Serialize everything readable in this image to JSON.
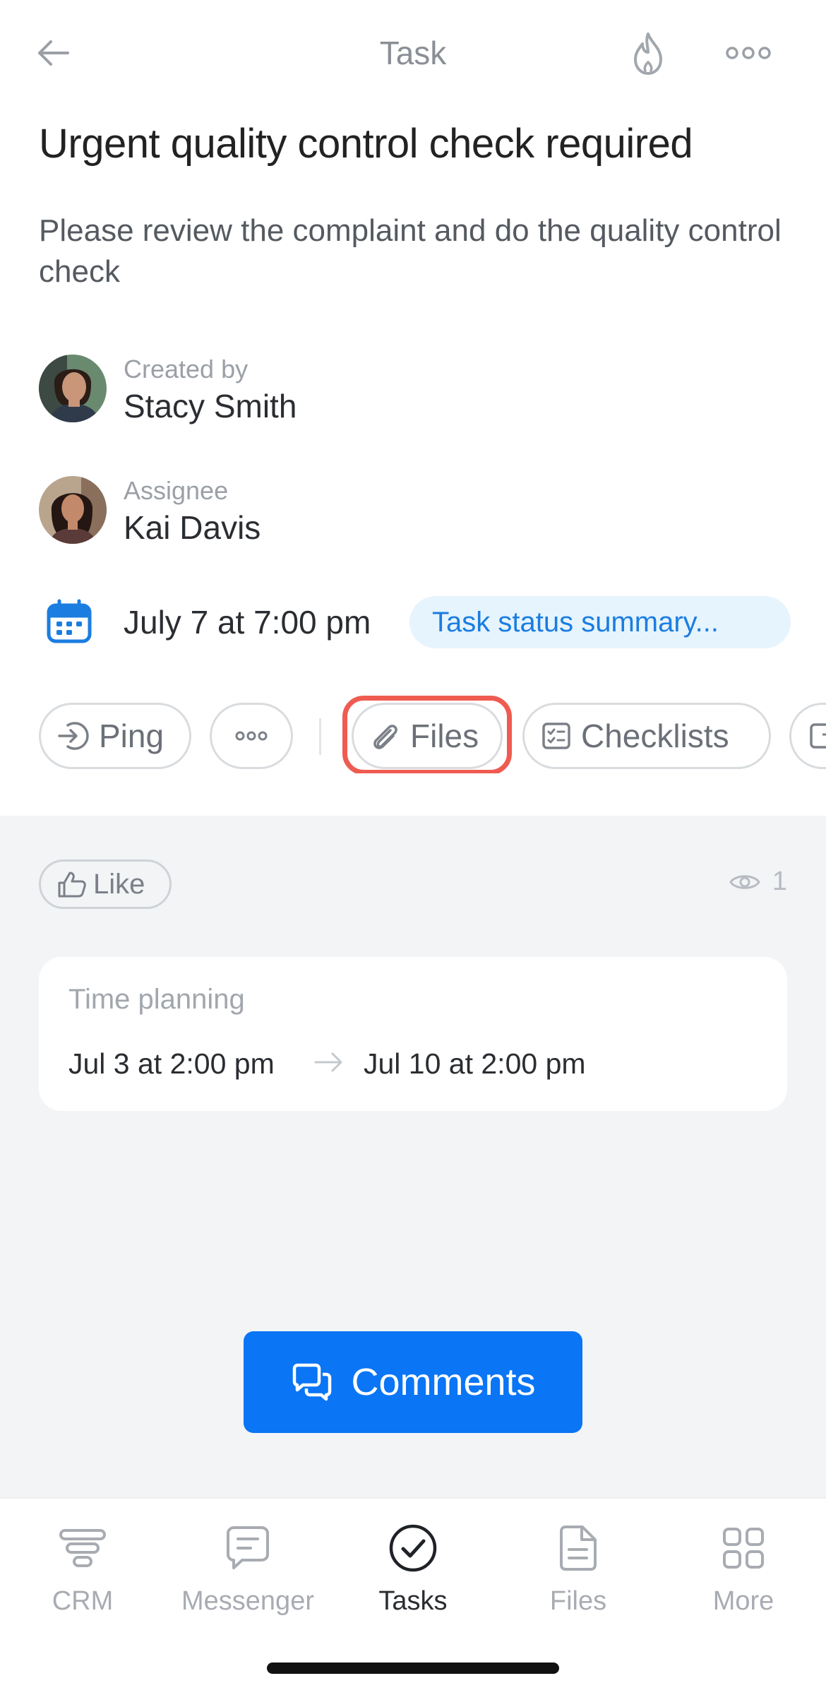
{
  "header": {
    "title": "Task",
    "back_icon": "arrow-left-icon",
    "fire_icon": "flame-icon",
    "menu_icon": "more-horizontal-icon"
  },
  "task": {
    "title": "Urgent quality control check required",
    "description": "Please review the complaint and do the quality control check"
  },
  "creator": {
    "role": "Created by",
    "name": "Stacy Smith"
  },
  "assignee": {
    "role": "Assignee",
    "name": "Kai Davis"
  },
  "deadline": {
    "text": "July 7 at 7:00 pm",
    "status_pill": "Task status summary...",
    "icon": "calendar-icon"
  },
  "actions": {
    "ping_label": "Ping",
    "more_icon": "more-horizontal-icon",
    "files_label": "Files",
    "checklists_label": "Checklists"
  },
  "feedback": {
    "like_label": "Like",
    "views_count": "1"
  },
  "time_planning": {
    "label": "Time planning",
    "start": "Jul 3 at 2:00 pm",
    "end": "Jul 10 at 2:00 pm"
  },
  "comments_button": {
    "label": "Comments"
  },
  "tabbar": {
    "items": [
      {
        "label": "CRM",
        "icon": "funnel-icon",
        "active": false
      },
      {
        "label": "Messenger",
        "icon": "chat-icon",
        "active": false
      },
      {
        "label": "Tasks",
        "icon": "check-circle-icon",
        "active": true
      },
      {
        "label": "Files",
        "icon": "file-icon",
        "active": false
      },
      {
        "label": "More",
        "icon": "grid-icon",
        "active": false
      }
    ]
  },
  "colors": {
    "accent": "#0a75f5",
    "highlight": "#ef5b50",
    "status_pill_bg": "#e6f4fd",
    "status_pill_text": "#1b7de0",
    "content_bg": "#f2f4f6"
  }
}
